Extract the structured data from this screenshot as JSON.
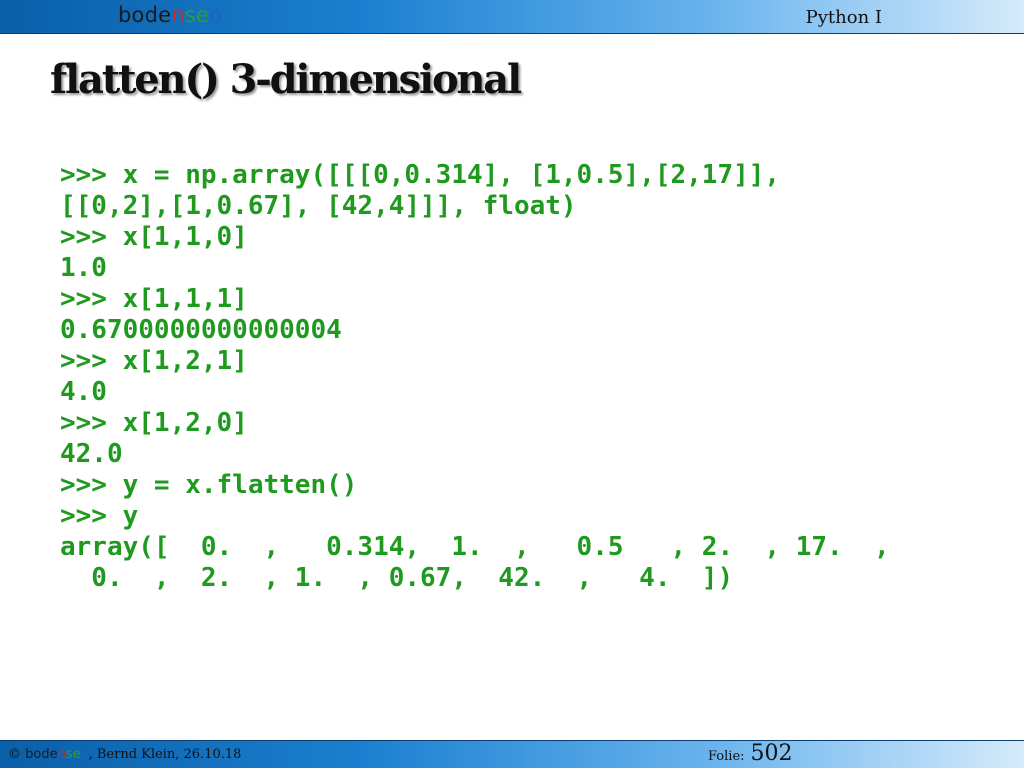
{
  "header": {
    "logo": {
      "p1": "bode",
      "p2": "n",
      "p3": "se",
      "p4": "o"
    },
    "course": "Python I"
  },
  "slide": {
    "title": "flatten() 3-dimensional",
    "code_lines": [
      ">>> x = np.array([[[0,0.314], [1,0.5],[2,17]],",
      "[[0,2],[1,0.67], [42,4]]], float)",
      ">>> x[1,1,0]",
      "1.0",
      ">>> x[1,1,1]",
      "0.6700000000000004",
      ">>> x[1,2,1]",
      "4.0",
      ">>> x[1,2,0]",
      "42.0",
      ">>> y = x.flatten()",
      ">>> y",
      "array([  0.  ,   0.314,  1.  ,   0.5   , 2.  , 17.  ,",
      "  0.  ,  2.  , 1.  , 0.67,  42.  ,   4.  ])"
    ]
  },
  "footer": {
    "copyright_symbol": "©",
    "brand": {
      "p1": "bode",
      "p2": "n",
      "p3": "se",
      "p4": "o"
    },
    "author_date": ", Bernd Klein, 26.10.18",
    "folio_label": "Folie:",
    "folio_number": "502"
  },
  "colors": {
    "header_gradient_start": "#0a5fa8",
    "header_gradient_end": "#d6ebfb",
    "code_green": "#1f9a1f",
    "logo_red": "#d7261e",
    "logo_green": "#2e9b3a",
    "logo_blue": "#1c63c2"
  }
}
